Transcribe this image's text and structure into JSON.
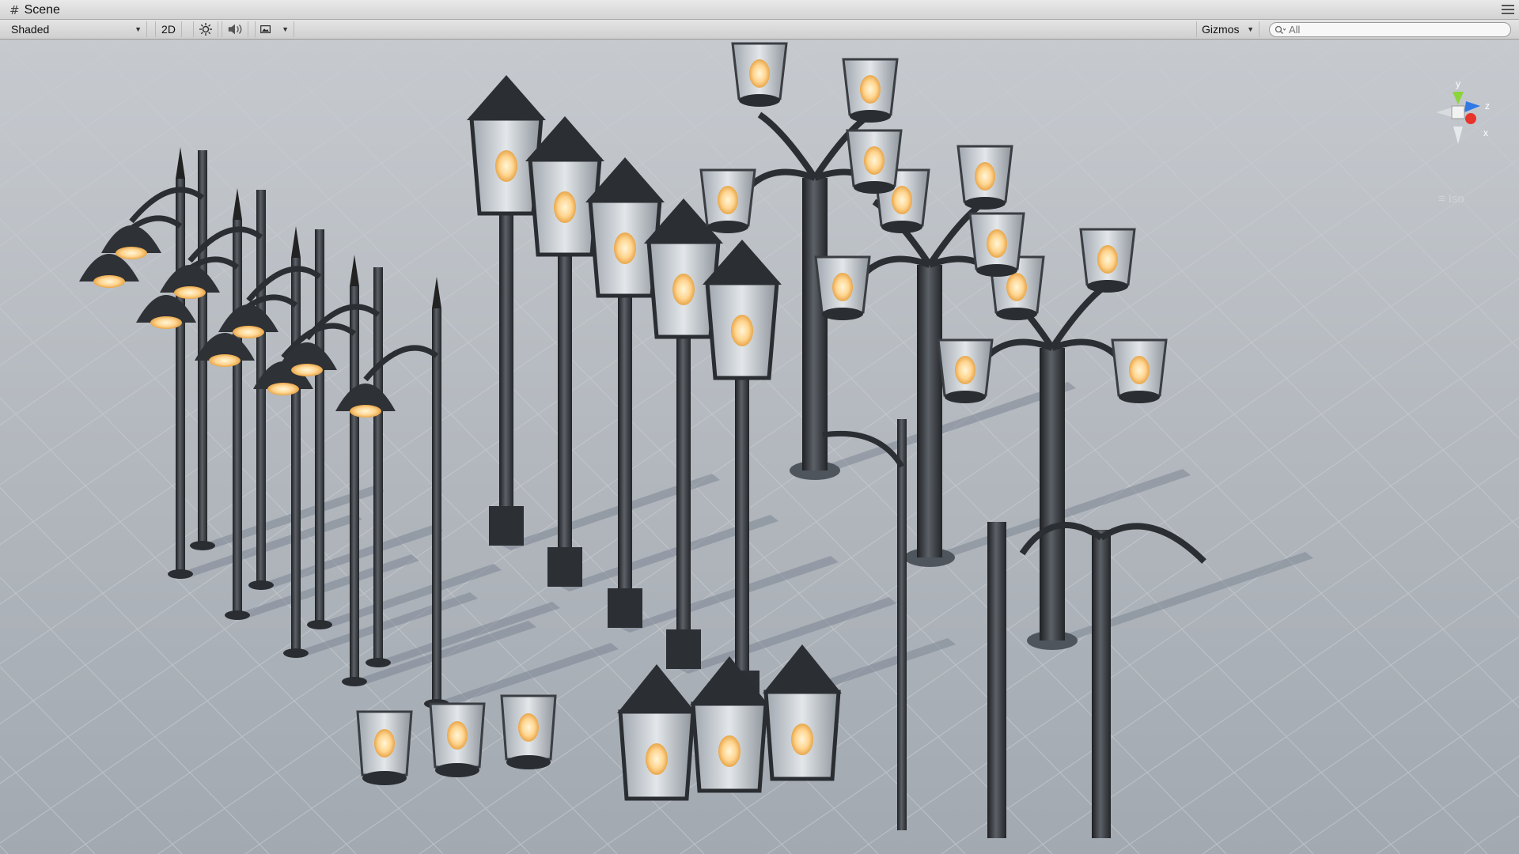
{
  "window": {
    "tab_title": "Scene"
  },
  "toolbar": {
    "draw_mode": "Shaded",
    "mode_2d": "2D",
    "gizmos": "Gizmos",
    "search_placeholder": "All"
  },
  "gizmo": {
    "y_label": "y",
    "x_label": "x",
    "z_label": "z",
    "projection": "Iso"
  },
  "icons": [
    "scene-hash-icon",
    "sun-light-icon",
    "speaker-audio-icon",
    "image-effects-icon",
    "search-icon",
    "panel-menu-icon"
  ],
  "colors": {
    "axis_y": "#8bd43a",
    "axis_x": "#e8352b",
    "axis_z": "#2f78e6",
    "lamp_glow": "#ffd590"
  }
}
